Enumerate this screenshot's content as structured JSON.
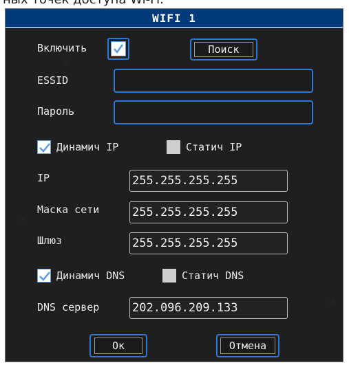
{
  "top_caption": "ных точек доступа Wi-Fi.",
  "dialog": {
    "title": "WIFI 1",
    "enable_label": "Включить",
    "enable_checked": true,
    "search_button": "Поиск",
    "essid_label": "ESSID",
    "essid_value": "",
    "password_label": "Пароль",
    "password_value": "",
    "ip_mode": {
      "dynamic_label": "Динамич IP",
      "dynamic_checked": true,
      "static_label": "Статич IP",
      "static_checked": false
    },
    "ip_label": "IP",
    "ip_value": "255.255.255.255",
    "mask_label": "Маска сети",
    "mask_value": "255.255.255.255",
    "gateway_label": "Шлюз",
    "gateway_value": "255.255.255.255",
    "dns_mode": {
      "dynamic_label": "Динамич DNS",
      "dynamic_checked": true,
      "static_label": "Статич DNS",
      "static_checked": false
    },
    "dns_label": "DNS сервер",
    "dns_value": "202.096.209.133",
    "ok_button": "Ок",
    "cancel_button": "Отмена"
  },
  "colors": {
    "background": "#1f1f1f",
    "titlebar": "#003a7a",
    "focus": "#2f79d6"
  }
}
